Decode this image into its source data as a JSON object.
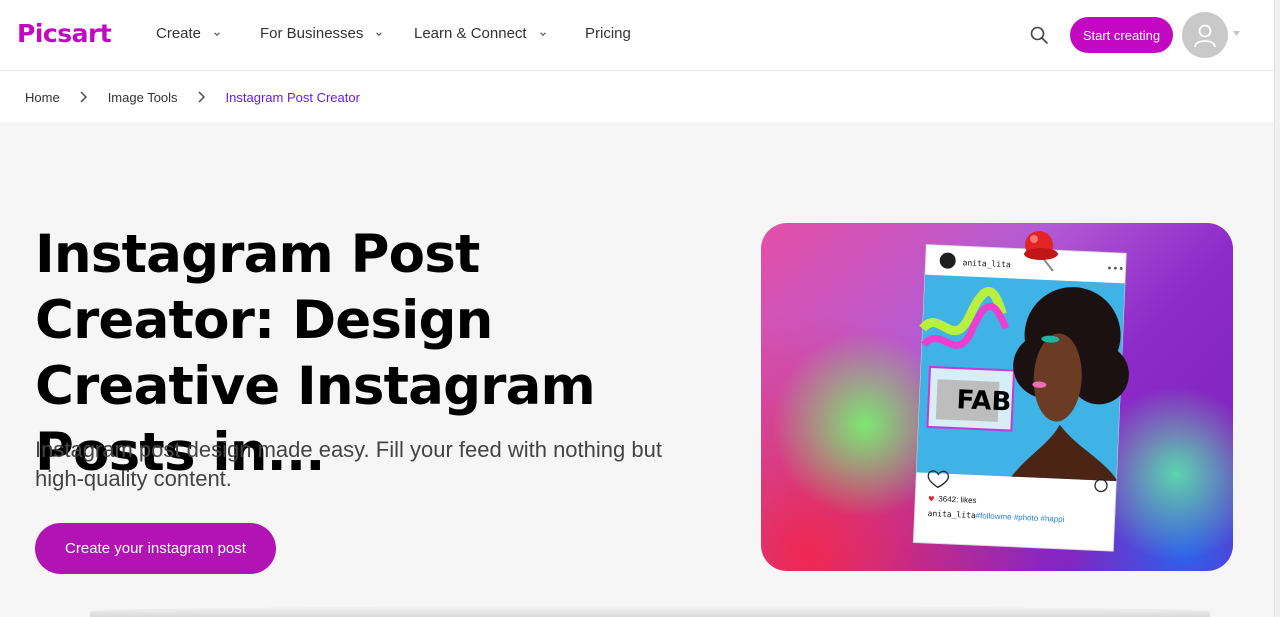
{
  "brand": {
    "logo_text": "Picsart",
    "accent": "#c209c1",
    "breadcrumb_current_color": "#6a1be0"
  },
  "nav": {
    "items": [
      {
        "label": "Create",
        "has_dropdown": true
      },
      {
        "label": "For Businesses",
        "has_dropdown": true
      },
      {
        "label": "Learn & Connect",
        "has_dropdown": true
      },
      {
        "label": "Pricing",
        "has_dropdown": false
      }
    ],
    "start_label": "Start creating",
    "icons": {
      "search": "search-icon",
      "avatar": "user-icon",
      "dropdown": "chevron-down-icon"
    }
  },
  "breadcrumb": {
    "items": [
      "Home",
      "Image Tools"
    ],
    "current": "Instagram Post Creator"
  },
  "hero": {
    "title": "Instagram Post Creator: Design Creative Instagram Posts in...",
    "subtitle": "Instagram post design made easy. Fill your feed with nothing but high-quality content.",
    "cta_label": "Create your instagram post"
  },
  "post_card": {
    "username": "anita_lita",
    "badge_text": "FAB",
    "likes_text": "3642: likes",
    "caption_user": "anita_lita",
    "caption_tags": "#followme #photo #happi"
  }
}
